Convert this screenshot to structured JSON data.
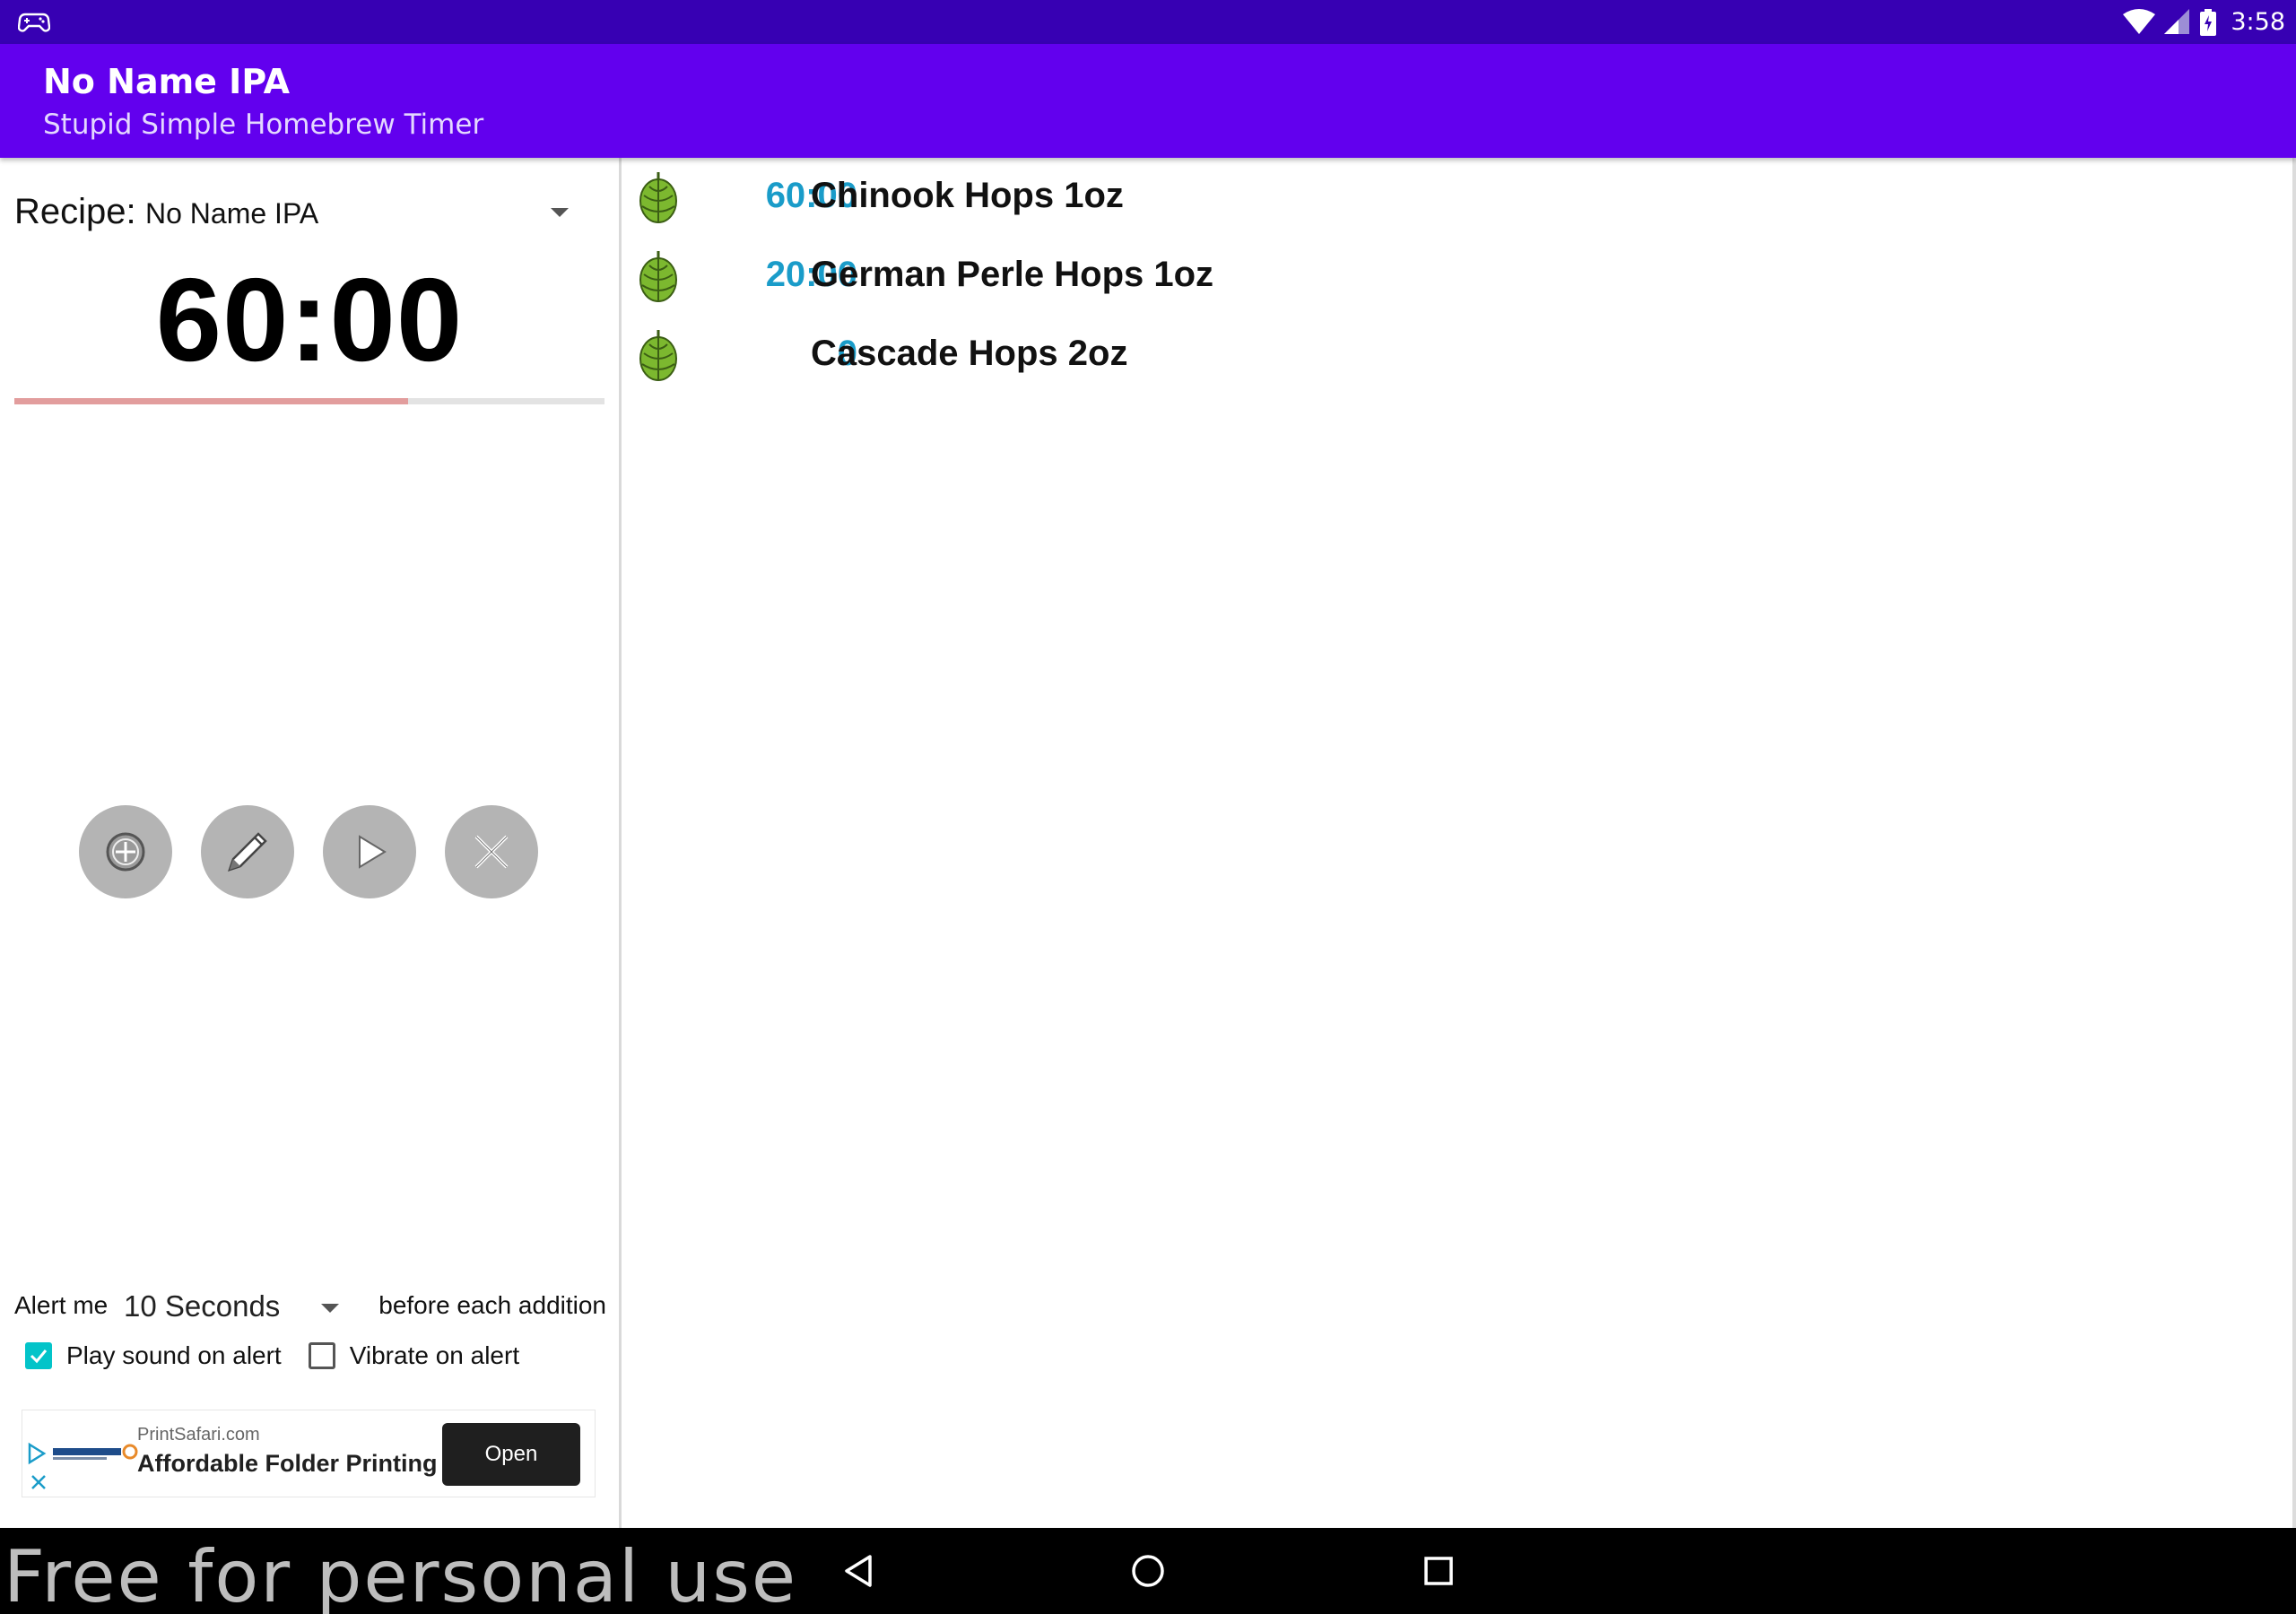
{
  "status_bar": {
    "time": "3:58",
    "left_icon": "gamepad-icon",
    "icons": [
      "wifi-icon",
      "signal-icon",
      "battery-charging-icon"
    ]
  },
  "app_bar": {
    "title": "No Name IPA",
    "subtitle": "Stupid Simple Homebrew Timer",
    "color": "#6200ee"
  },
  "recipe": {
    "label": "Recipe:",
    "selected": "No Name IPA"
  },
  "timer": {
    "display": "60:00",
    "progress": 0.667
  },
  "controls": [
    {
      "name": "add-button",
      "icon": "add-circle-icon"
    },
    {
      "name": "edit-button",
      "icon": "pencil-icon"
    },
    {
      "name": "play-button",
      "icon": "play-icon"
    },
    {
      "name": "cancel-button",
      "icon": "close-icon"
    }
  ],
  "alert": {
    "label": "Alert me",
    "selected": "10 Seconds",
    "suffix": "before each addition",
    "play_sound_label": "Play sound on alert",
    "play_sound_checked": true,
    "vibrate_label": "Vibrate on alert",
    "vibrate_checked": false
  },
  "ad": {
    "domain": "PrintSafari.com",
    "headline": "Affordable Folder Printing",
    "button": "Open",
    "logo": "printsafari-logo"
  },
  "hops": [
    {
      "time": "60:00",
      "name": "Chinook Hops 1oz"
    },
    {
      "time": "20:00",
      "name": "German Perle Hops 1oz"
    },
    {
      "time": "0",
      "name": "Cascade Hops 2oz"
    }
  ],
  "nav": {
    "watermark": "Free for personal use",
    "buttons": [
      "back-icon",
      "home-icon",
      "recents-icon"
    ]
  }
}
